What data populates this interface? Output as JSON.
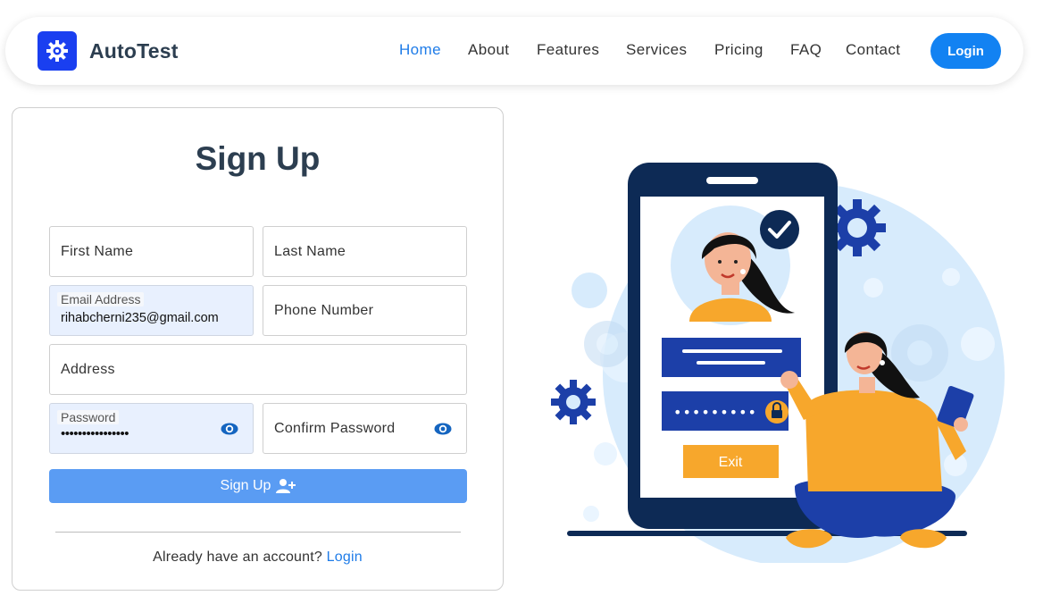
{
  "brand": {
    "name": "AutoTest",
    "logo_icon": "gear-icon"
  },
  "nav": {
    "items": [
      {
        "label": "Home",
        "active": true
      },
      {
        "label": "About",
        "active": false
      },
      {
        "label": "Features",
        "active": false
      },
      {
        "label": "Services",
        "active": false
      },
      {
        "label": "Pricing",
        "active": false
      },
      {
        "label": "FAQ",
        "active": false
      },
      {
        "label": "Contact",
        "active": false
      }
    ],
    "login_label": "Login"
  },
  "signup": {
    "title": "Sign Up",
    "first_name": {
      "placeholder": "First Name"
    },
    "last_name": {
      "placeholder": "Last Name"
    },
    "email": {
      "label": "Email Address",
      "value": "rihabcherni235@gmail.com"
    },
    "phone": {
      "placeholder": "Phone Number"
    },
    "address": {
      "placeholder": "Address"
    },
    "password": {
      "label": "Password",
      "masked_value": "••••••••••••••••"
    },
    "confirm_password": {
      "placeholder": "Confirm Password"
    },
    "submit_label": "Sign Up",
    "submit_icon": "user-plus-icon",
    "footer_text": "Already have an account?",
    "footer_link": "Login"
  },
  "illustration": {
    "input_dots": "•••••••••",
    "exit_label": "Exit"
  },
  "colors": {
    "primary": "#1282f2",
    "brand_logo": "#1a3ff0",
    "heading": "#2c3e50",
    "submit_button": "#5a9cf3",
    "autofill_bg": "#e8f0fe",
    "phone_dark": "#0d2a55",
    "accent_orange": "#f7a72c"
  }
}
